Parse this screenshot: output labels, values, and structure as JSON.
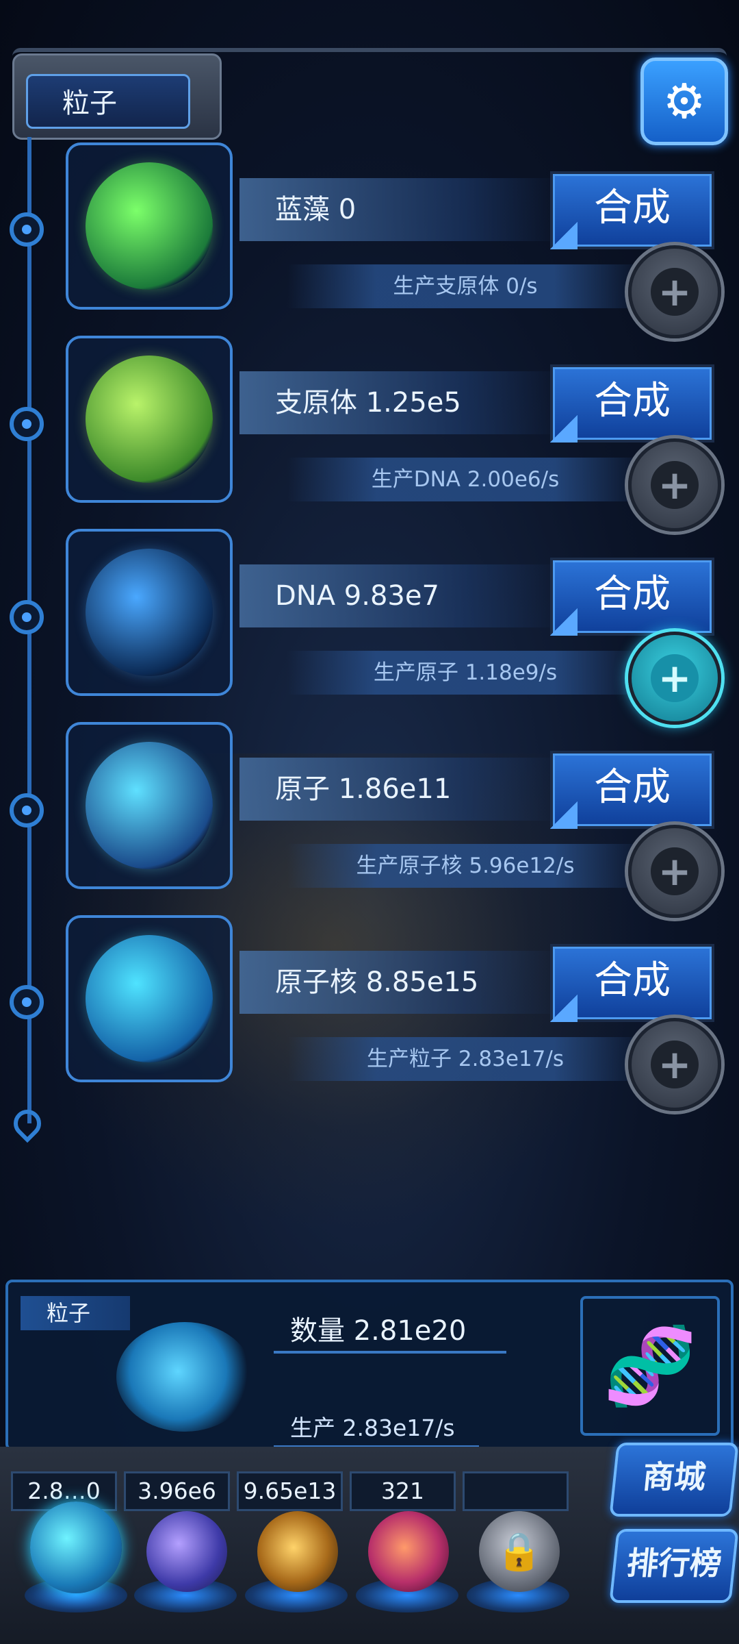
{
  "header": {
    "title": "粒子"
  },
  "items": [
    {
      "name": "蓝藻 0",
      "produce": "生产支原体 0/s",
      "synth_label": "合成",
      "plus_active": false,
      "orb_colors": [
        "#7cff6a",
        "#1b7a3a"
      ]
    },
    {
      "name": "支原体 1.25e5",
      "produce": "生产DNA 2.00e6/s",
      "synth_label": "合成",
      "plus_active": false,
      "orb_colors": [
        "#b9f36a",
        "#3d8a2a"
      ]
    },
    {
      "name": "DNA 9.83e7",
      "produce": "生产原子 1.18e9/s",
      "synth_label": "合成",
      "plus_active": true,
      "orb_colors": [
        "#4aa8ff",
        "#0b2a55"
      ]
    },
    {
      "name": "原子 1.86e11",
      "produce": "生产原子核 5.96e12/s",
      "synth_label": "合成",
      "plus_active": false,
      "orb_colors": [
        "#5fe0ff",
        "#1a4a8a"
      ]
    },
    {
      "name": "原子核 8.85e15",
      "produce": "生产粒子 2.83e17/s",
      "synth_label": "合成",
      "plus_active": false,
      "orb_colors": [
        "#4fe3ff",
        "#1463a8"
      ]
    }
  ],
  "summary": {
    "tab_label": "粒子",
    "count": "数量 2.81e20",
    "produce": "生产 2.83e17/s"
  },
  "dock": {
    "slots": [
      "2.8…0",
      "3.96e6",
      "9.65e13",
      "321",
      ""
    ],
    "shop_label": "商城",
    "rank_label": "排行榜"
  },
  "colors": {
    "accent": "#2c74d8",
    "panel": "#0a1a34"
  }
}
